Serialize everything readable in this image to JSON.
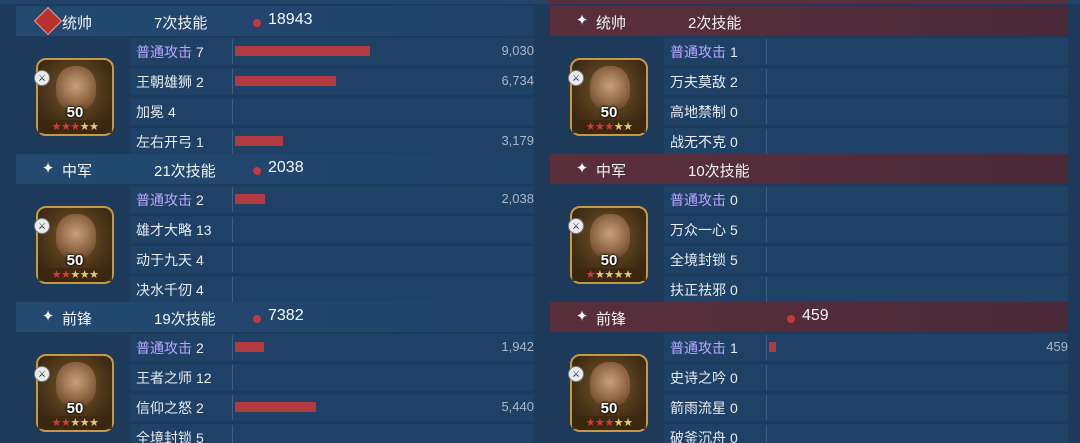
{
  "left": {
    "blocks": [
      {
        "role": "统帅",
        "casts": "7次技能",
        "total": "18943",
        "role_icon": "sword-badge-icon",
        "level": "50",
        "stars_red": 3,
        "stars_total": 5,
        "skills": [
          {
            "name": "普通攻击",
            "count": "7",
            "value": "9,030",
            "basic": true,
            "fill": 0.465
          },
          {
            "name": "王朝雄狮",
            "count": "2",
            "value": "6,734",
            "basic": false,
            "fill": 0.347
          },
          {
            "name": "加冕",
            "count": "4",
            "value": "",
            "basic": false,
            "fill": 0
          },
          {
            "name": "左右开弓",
            "count": "1",
            "value": "3,179",
            "basic": false,
            "fill": 0.164
          }
        ]
      },
      {
        "role": "中军",
        "casts": "21次技能",
        "total": "2038",
        "role_icon": "sparkle-icon",
        "level": "50",
        "stars_red": 2,
        "stars_total": 5,
        "skills": [
          {
            "name": "普通攻击",
            "count": "2",
            "value": "2,038",
            "basic": true,
            "fill": 0.105
          },
          {
            "name": "雄才大略",
            "count": "13",
            "value": "",
            "basic": false,
            "fill": 0
          },
          {
            "name": "动于九天",
            "count": "4",
            "value": "",
            "basic": false,
            "fill": 0
          },
          {
            "name": "决水千仞",
            "count": "4",
            "value": "",
            "basic": false,
            "fill": 0
          }
        ]
      },
      {
        "role": "前锋",
        "casts": "19次技能",
        "total": "7382",
        "role_icon": "sparkle-icon",
        "level": "50",
        "stars_red": 2,
        "stars_total": 5,
        "skills": [
          {
            "name": "普通攻击",
            "count": "2",
            "value": "1,942",
            "basic": true,
            "fill": 0.1
          },
          {
            "name": "王者之师",
            "count": "12",
            "value": "",
            "basic": false,
            "fill": 0
          },
          {
            "name": "信仰之怒",
            "count": "2",
            "value": "5,440",
            "basic": false,
            "fill": 0.28
          },
          {
            "name": "全境封锁",
            "count": "5",
            "value": "",
            "basic": false,
            "fill": 0
          }
        ]
      }
    ]
  },
  "right": {
    "blocks": [
      {
        "role": "统帅",
        "casts": "2次技能",
        "total": "",
        "role_icon": "sparkle-icon",
        "level": "50",
        "stars_red": 3,
        "stars_total": 5,
        "skills": [
          {
            "name": "普通攻击",
            "count": "1",
            "value": "",
            "basic": true,
            "fill": 0
          },
          {
            "name": "万夫莫敌",
            "count": "2",
            "value": "",
            "basic": false,
            "fill": 0
          },
          {
            "name": "高地禁制",
            "count": "0",
            "value": "",
            "basic": false,
            "fill": 0
          },
          {
            "name": "战无不克",
            "count": "0",
            "value": "",
            "basic": false,
            "fill": 0
          }
        ]
      },
      {
        "role": "中军",
        "casts": "10次技能",
        "total": "",
        "role_icon": "sparkle-icon",
        "level": "50",
        "stars_red": 1,
        "stars_total": 5,
        "skills": [
          {
            "name": "普通攻击",
            "count": "0",
            "value": "",
            "basic": true,
            "fill": 0
          },
          {
            "name": "万众一心",
            "count": "5",
            "value": "",
            "basic": false,
            "fill": 0
          },
          {
            "name": "全境封锁",
            "count": "5",
            "value": "",
            "basic": false,
            "fill": 0
          },
          {
            "name": "扶正祛邪",
            "count": "0",
            "value": "",
            "basic": false,
            "fill": 0
          }
        ]
      },
      {
        "role": "前锋",
        "casts": "",
        "total": "459",
        "role_icon": "sparkle-icon",
        "level": "50",
        "stars_red": 3,
        "stars_total": 5,
        "skills": [
          {
            "name": "普通攻击",
            "count": "1",
            "value": "459",
            "basic": true,
            "fill": 0.024
          },
          {
            "name": "史诗之吟",
            "count": "0",
            "value": "",
            "basic": false,
            "fill": 0
          },
          {
            "name": "箭雨流星",
            "count": "0",
            "value": "",
            "basic": false,
            "fill": 0
          },
          {
            "name": "破釜沉舟",
            "count": "0",
            "value": "",
            "basic": false,
            "fill": 0
          }
        ]
      }
    ]
  },
  "colors": {
    "bar": "#b23a40",
    "basic_skill": "#b8a8ff",
    "right_header": "#5a2f3c",
    "left_header": "#244a72"
  }
}
